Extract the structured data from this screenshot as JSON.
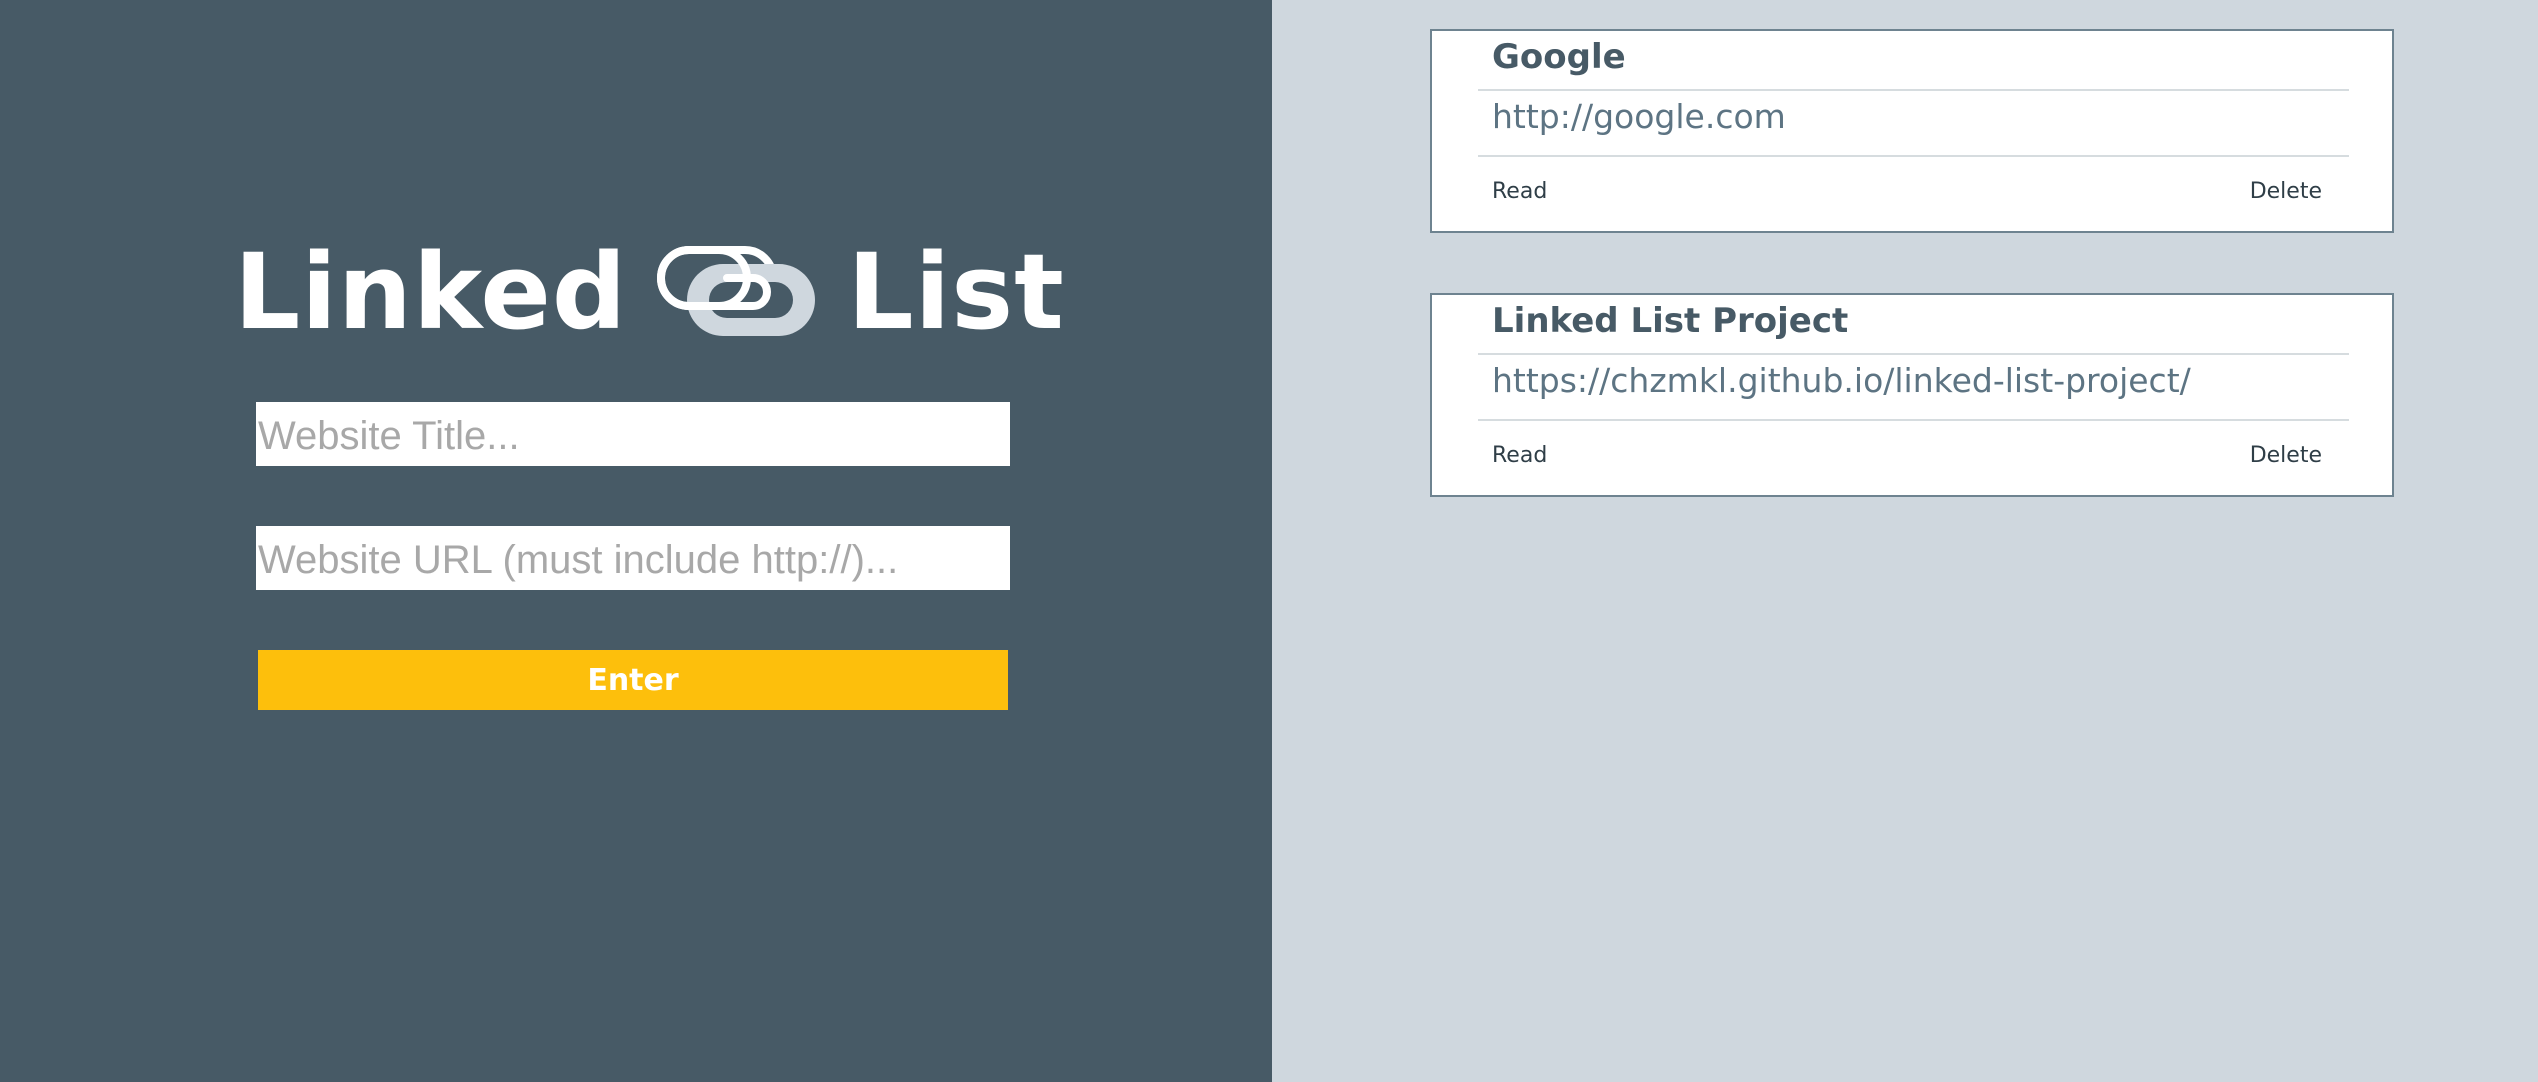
{
  "app": {
    "title_left": "Linked",
    "title_right": "List",
    "logo_icon": "paperclip-link-icon"
  },
  "form": {
    "title_placeholder": "Website Title...",
    "title_value": "",
    "url_placeholder": "Website URL (must include http://)...",
    "url_value": "",
    "enter_label": "Enter"
  },
  "bookmarks": [
    {
      "title": "Google",
      "url": "http://google.com",
      "read_label": "Read",
      "delete_label": "Delete"
    },
    {
      "title": "Linked List Project",
      "url": "https://chzmkl.github.io/linked-list-project/",
      "read_label": "Read",
      "delete_label": "Delete"
    }
  ],
  "colors": {
    "left_background": "#475a66",
    "right_background": "#cfd7de",
    "accent": "#fdbf0c",
    "card_border": "#6e8390",
    "title_text": "#475a66",
    "url_text": "#5d7483"
  }
}
